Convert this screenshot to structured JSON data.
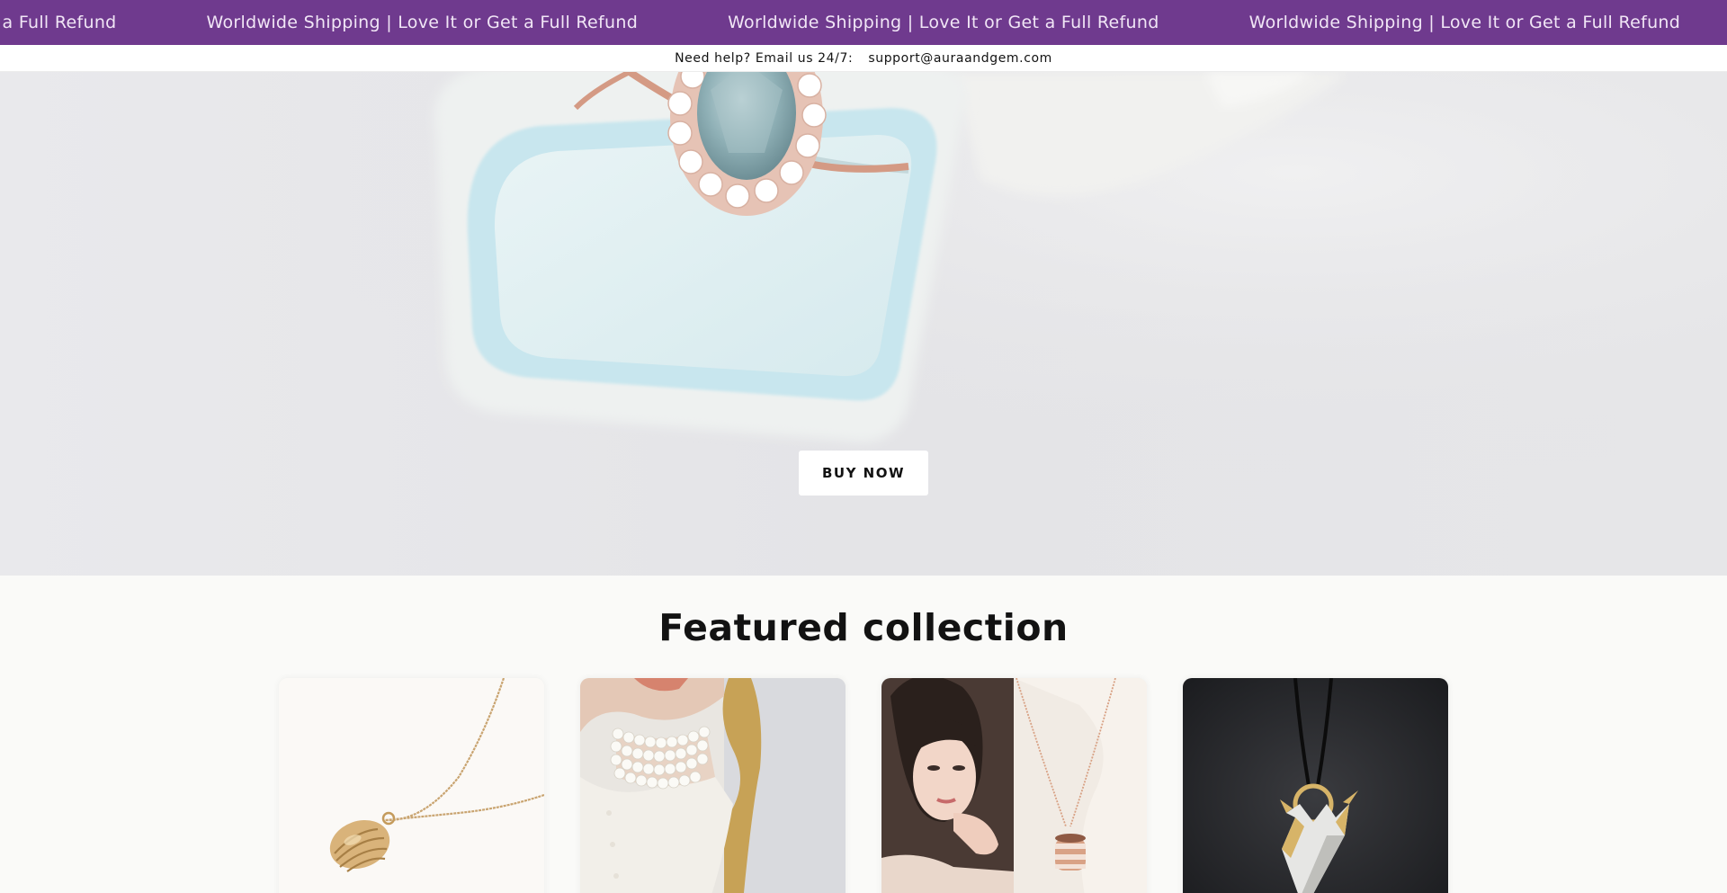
{
  "announcement": {
    "messages": [
      "Worldwide Shipping | Love It or Get a Full Refund",
      "Worldwide Shipping | Love It or Get a Full Refund",
      "Worldwide Shipping | Love It or Get a Full Refund",
      "Worldwide Shipping | Love It or Get a Full Refund"
    ],
    "background": "#6f3a8e"
  },
  "help": {
    "label": "Need help? Email us 24/7:",
    "email": "support@auraandgem.com"
  },
  "hero": {
    "button_label": "BUY NOW"
  },
  "featured": {
    "title": "Featured collection",
    "products": [
      {
        "image": "gold-shell-pendant-necklace"
      },
      {
        "image": "layered-pearl-choker"
      },
      {
        "image": "rose-gold-cylinder-pendant"
      },
      {
        "image": "geometric-gold-pendant-on-cord"
      }
    ]
  }
}
